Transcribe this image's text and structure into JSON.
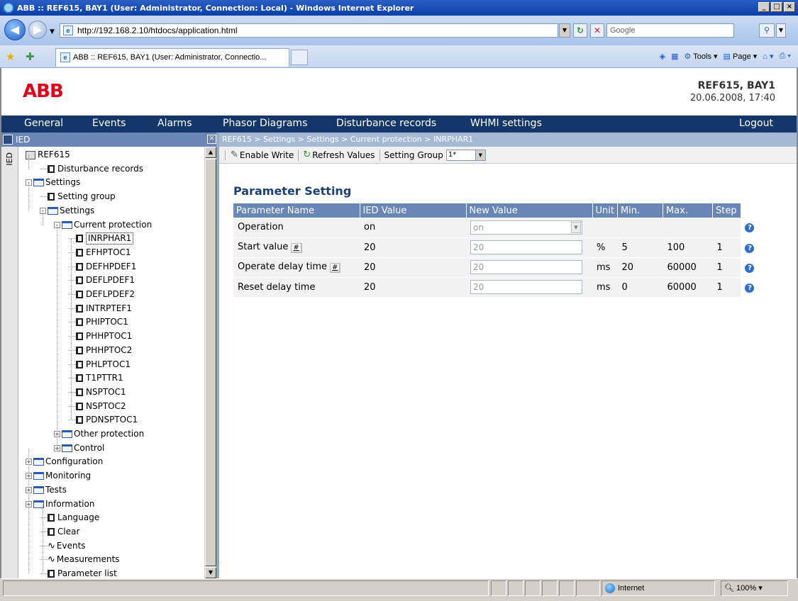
{
  "browser": {
    "window_title": "ABB :: REF615, BAY1 (User: Administrator, Connection: Local) - Windows Internet Explorer",
    "url": "http://192.168.2.10/htdocs/application.html",
    "search_placeholder": "Google",
    "tab_title": "ABB :: REF615, BAY1 (User: Administrator, Connectio...",
    "cmd_tools": "Tools",
    "cmd_page": "Page",
    "status_zone": "Internet",
    "status_zoom": "100%"
  },
  "header": {
    "logo": "ABB",
    "device_name": "REF615, BAY1",
    "datetime": "20.06.2008, 17:40"
  },
  "menu": {
    "general": "General",
    "events": "Events",
    "alarms": "Alarms",
    "phasor": "Phasor Diagrams",
    "disturbance": "Disturbance records",
    "whmi": "WHMI settings",
    "logout": "Logout"
  },
  "left_pane": {
    "title": "IED",
    "side_tab": "IED",
    "tree": [
      {
        "label": "REF615",
        "indent": 0,
        "icon": "doc",
        "exp": ""
      },
      {
        "label": "Disturbance records",
        "indent": 1,
        "icon": "leaf",
        "exp": ""
      },
      {
        "label": "Settings",
        "indent": 0,
        "icon": "folder",
        "exp": "-"
      },
      {
        "label": "Setting group",
        "indent": 1,
        "icon": "leaf",
        "exp": ""
      },
      {
        "label": "Settings",
        "indent": 1,
        "icon": "folder",
        "exp": "-"
      },
      {
        "label": "Current protection",
        "indent": 2,
        "icon": "folder",
        "exp": "-"
      },
      {
        "label": "INRPHAR1",
        "indent": 3,
        "icon": "leaf",
        "exp": "",
        "selected": true
      },
      {
        "label": "EFHPTOC1",
        "indent": 3,
        "icon": "leaf",
        "exp": ""
      },
      {
        "label": "DEFHPDEF1",
        "indent": 3,
        "icon": "leaf",
        "exp": ""
      },
      {
        "label": "DEFLPDEF1",
        "indent": 3,
        "icon": "leaf",
        "exp": ""
      },
      {
        "label": "DEFLPDEF2",
        "indent": 3,
        "icon": "leaf",
        "exp": ""
      },
      {
        "label": "INTRPTEF1",
        "indent": 3,
        "icon": "leaf",
        "exp": ""
      },
      {
        "label": "PHIPTOC1",
        "indent": 3,
        "icon": "leaf",
        "exp": ""
      },
      {
        "label": "PHHPTOC1",
        "indent": 3,
        "icon": "leaf",
        "exp": ""
      },
      {
        "label": "PHHPTOC2",
        "indent": 3,
        "icon": "leaf",
        "exp": ""
      },
      {
        "label": "PHLPTOC1",
        "indent": 3,
        "icon": "leaf",
        "exp": ""
      },
      {
        "label": "T1PTTR1",
        "indent": 3,
        "icon": "leaf",
        "exp": ""
      },
      {
        "label": "NSPTOC1",
        "indent": 3,
        "icon": "leaf",
        "exp": ""
      },
      {
        "label": "NSPTOC2",
        "indent": 3,
        "icon": "leaf",
        "exp": ""
      },
      {
        "label": "PDNSPTOC1",
        "indent": 3,
        "icon": "leaf",
        "exp": ""
      },
      {
        "label": "Other protection",
        "indent": 2,
        "icon": "folder",
        "exp": "+"
      },
      {
        "label": "Control",
        "indent": 2,
        "icon": "folder",
        "exp": "+"
      },
      {
        "label": "Configuration",
        "indent": 0,
        "icon": "folder",
        "exp": "+"
      },
      {
        "label": "Monitoring",
        "indent": 0,
        "icon": "folder",
        "exp": "+"
      },
      {
        "label": "Tests",
        "indent": 0,
        "icon": "folder",
        "exp": "+"
      },
      {
        "label": "Information",
        "indent": 0,
        "icon": "folder",
        "exp": "+"
      },
      {
        "label": "Language",
        "indent": 1,
        "icon": "leaf",
        "exp": ""
      },
      {
        "label": "Clear",
        "indent": 1,
        "icon": "leaf",
        "exp": ""
      },
      {
        "label": "Events",
        "indent": 1,
        "icon": "wave",
        "exp": ""
      },
      {
        "label": "Measurements",
        "indent": 1,
        "icon": "wave",
        "exp": ""
      },
      {
        "label": "Parameter list",
        "indent": 1,
        "icon": "leaf",
        "exp": ""
      }
    ]
  },
  "breadcrumb": "REF615 > Settings > Settings > Current protection > INRPHAR1",
  "toolbar": {
    "enable_write": "Enable Write",
    "refresh_values": "Refresh Values",
    "setting_group_label": "Setting Group",
    "setting_group_value": "1*"
  },
  "params": {
    "title": "Parameter Setting",
    "headers": [
      "Parameter Name",
      "IED Value",
      "New Value",
      "Unit",
      "Min.",
      "Max.",
      "Step"
    ],
    "rows": [
      {
        "name": "Operation",
        "hash": false,
        "ied": "on",
        "new": "on",
        "dropdown": true,
        "unit": "",
        "min": "",
        "max": "",
        "step": ""
      },
      {
        "name": "Start value",
        "hash": true,
        "ied": "20",
        "new": "20",
        "dropdown": false,
        "unit": "%",
        "min": "5",
        "max": "100",
        "step": "1"
      },
      {
        "name": "Operate delay time",
        "hash": true,
        "ied": "20",
        "new": "20",
        "dropdown": false,
        "unit": "ms",
        "min": "20",
        "max": "60000",
        "step": "1"
      },
      {
        "name": "Reset delay time",
        "hash": false,
        "ied": "20",
        "new": "20",
        "dropdown": false,
        "unit": "ms",
        "min": "0",
        "max": "60000",
        "step": "1"
      }
    ]
  },
  "colors": {
    "menu_bg": "#15366a",
    "pane_header": "#6a86b6",
    "abb_red": "#e2001a",
    "title_blue": "#1a3f7a"
  }
}
